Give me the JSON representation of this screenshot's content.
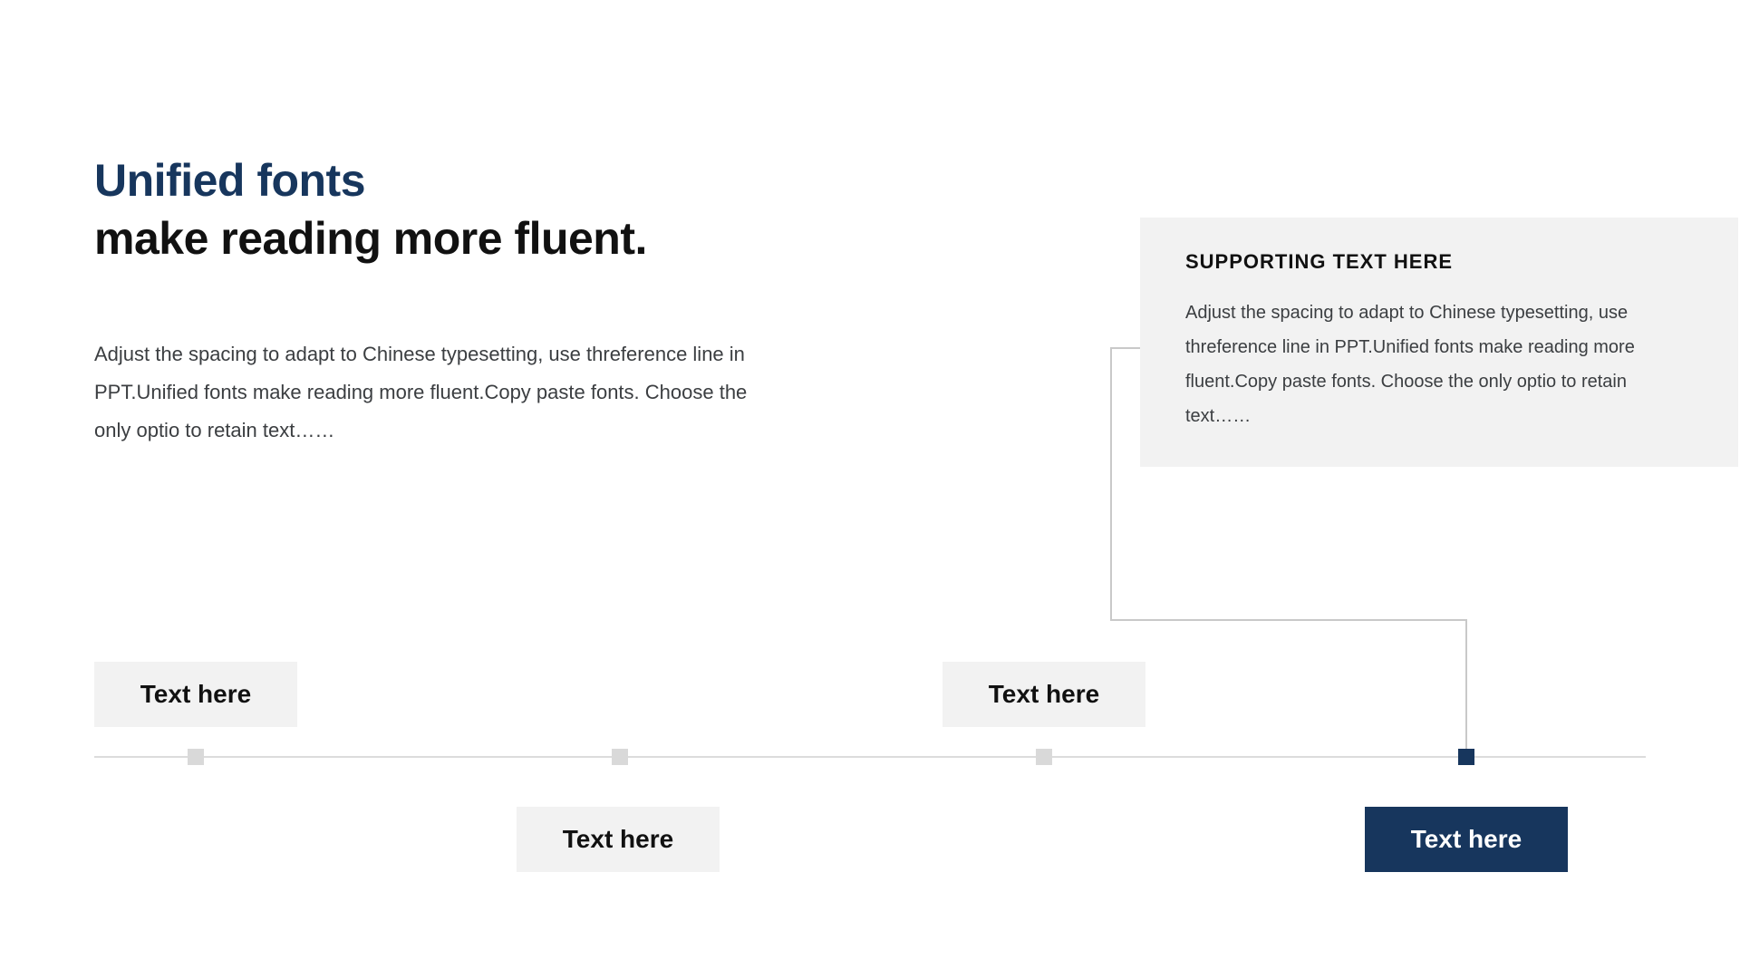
{
  "title": {
    "line1": "Unified fonts",
    "line2": "make reading more fluent."
  },
  "body": "Adjust the spacing to adapt to Chinese typesetting, use threference line in PPT.Unified fonts make reading more fluent.Copy paste fonts. Choose the only optio to retain text……",
  "support": {
    "heading": "SUPPORTING TEXT HERE",
    "body": "Adjust the spacing to adapt to Chinese typesetting, use threference line in PPT.Unified fonts make reading more fluent.Copy paste fonts. Choose the only optio to retain text……"
  },
  "timeline": {
    "items": [
      {
        "label": "Text here",
        "position": "above",
        "active": false
      },
      {
        "label": "Text here",
        "position": "below",
        "active": false
      },
      {
        "label": "Text here",
        "position": "above",
        "active": false
      },
      {
        "label": "Text here",
        "position": "below",
        "active": true
      }
    ]
  },
  "colors": {
    "accent": "#17365d",
    "muted_bg": "#f2f2f2",
    "marker_inactive": "#d9d9d9",
    "line": "#dcdcdc",
    "connector": "#c9c9c9",
    "text_body": "#3b3e41"
  }
}
